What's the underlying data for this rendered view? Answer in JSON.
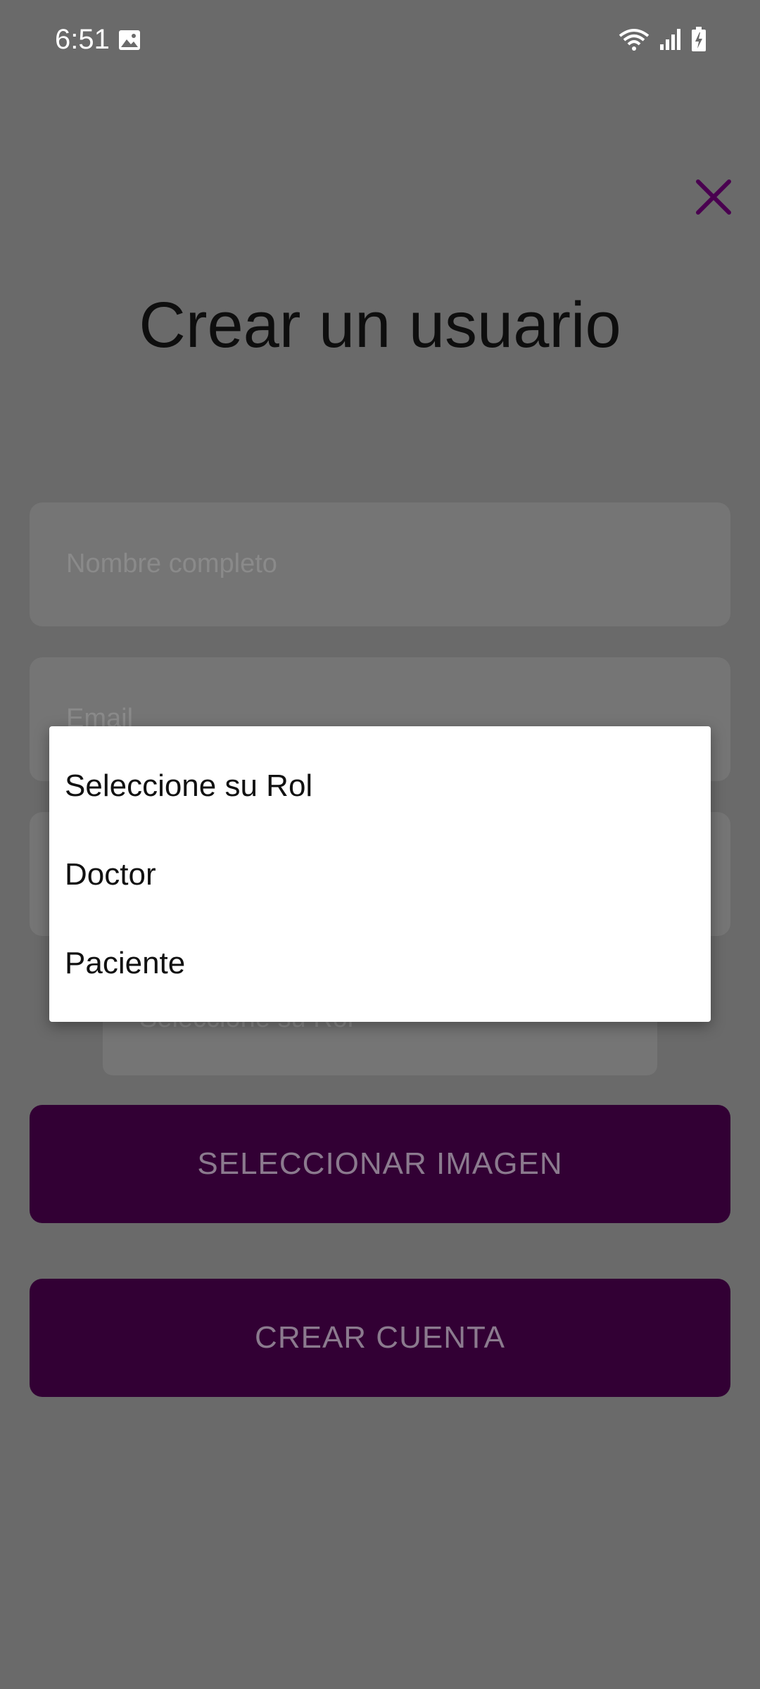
{
  "status_bar": {
    "time": "6:51",
    "icons": [
      "image-icon",
      "wifi-icon",
      "signal-icon",
      "battery-icon"
    ]
  },
  "screen": {
    "title": "Crear un usuario",
    "close_icon": "close-icon"
  },
  "form": {
    "name_placeholder": "Nombre completo",
    "email_placeholder": "Email",
    "password_placeholder": "",
    "role_select_placeholder": "Seleccione su Rol"
  },
  "buttons": {
    "select_image": "SELECCIONAR IMAGEN",
    "create_account": "CREAR CUENTA"
  },
  "dropdown": {
    "options": [
      "Seleccione su Rol",
      "Doctor",
      "Paciente"
    ]
  },
  "colors": {
    "primary": "#320034",
    "accent": "#4a0050",
    "scrim": "#6a6a6a"
  }
}
